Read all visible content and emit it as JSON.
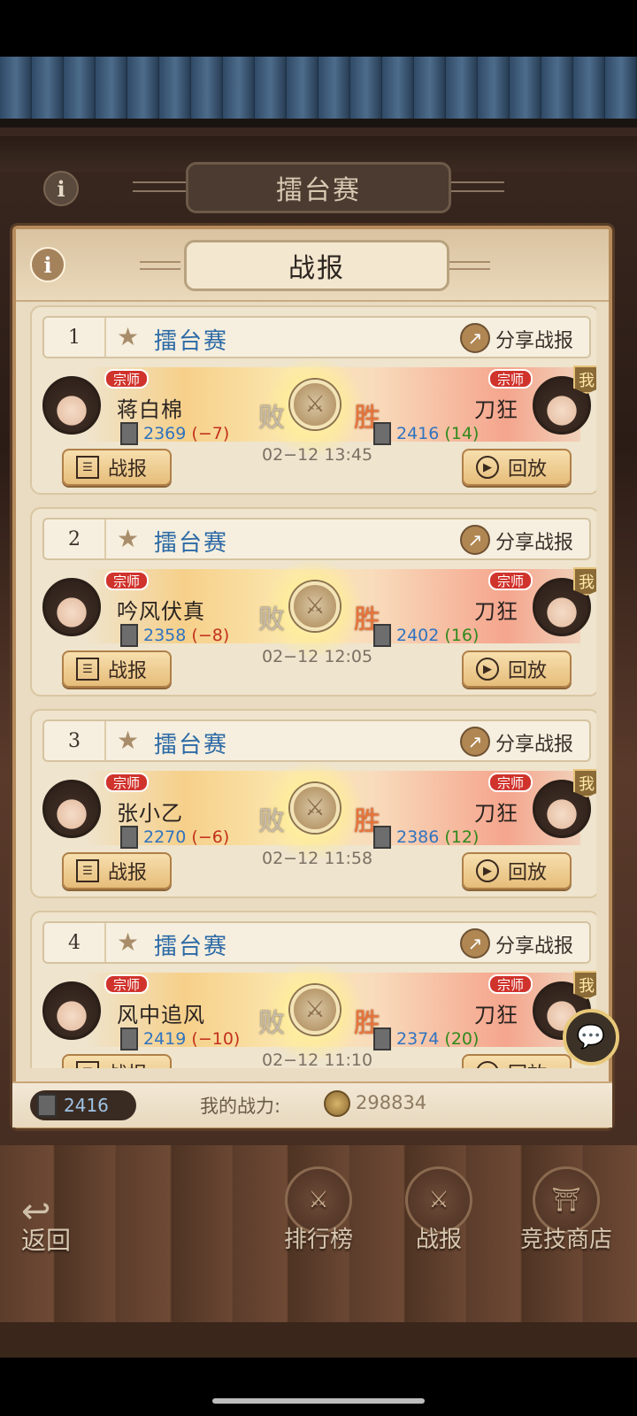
{
  "page": {
    "title": "擂台赛"
  },
  "panel": {
    "title": "战报"
  },
  "reports": [
    {
      "rank": "1",
      "mode": "擂台赛",
      "share_label": "分享战报",
      "left": {
        "tag": "宗师",
        "name": "蒋白棉",
        "rating": "2369",
        "delta": "(−7)"
      },
      "right": {
        "tag": "宗师",
        "name": "刀狂",
        "rating": "2416",
        "delta": "(14)",
        "badge": "我"
      },
      "left_result": "败",
      "right_result": "胜",
      "time": "02−12 13:45",
      "report_label": "战报",
      "replay_label": "回放"
    },
    {
      "rank": "2",
      "mode": "擂台赛",
      "share_label": "分享战报",
      "left": {
        "tag": "宗师",
        "name": "吟风伏真",
        "rating": "2358",
        "delta": "(−8)"
      },
      "right": {
        "tag": "宗师",
        "name": "刀狂",
        "rating": "2402",
        "delta": "(16)",
        "badge": "我"
      },
      "left_result": "败",
      "right_result": "胜",
      "time": "02−12 12:05",
      "report_label": "战报",
      "replay_label": "回放"
    },
    {
      "rank": "3",
      "mode": "擂台赛",
      "share_label": "分享战报",
      "left": {
        "tag": "宗师",
        "name": "张小乙",
        "rating": "2270",
        "delta": "(−6)"
      },
      "right": {
        "tag": "宗师",
        "name": "刀狂",
        "rating": "2386",
        "delta": "(12)",
        "badge": "我"
      },
      "left_result": "败",
      "right_result": "胜",
      "time": "02−12 11:58",
      "report_label": "战报",
      "replay_label": "回放"
    },
    {
      "rank": "4",
      "mode": "擂台赛",
      "share_label": "分享战报",
      "left": {
        "tag": "宗师",
        "name": "风中追风",
        "rating": "2419",
        "delta": "(−10)"
      },
      "right": {
        "tag": "宗师",
        "name": "刀狂",
        "rating": "2374",
        "delta": "(20)",
        "badge": "我"
      },
      "left_result": "败",
      "right_result": "胜",
      "time": "02−12 11:10",
      "report_label": "战报",
      "replay_label": "回放"
    }
  ],
  "footer": {
    "my_rating": "2416",
    "power_label": "我的战力:",
    "power_value": "298834"
  },
  "nav": {
    "back": "返回",
    "leaderboard": "排行榜",
    "reports": "战报",
    "shop": "竞技商店"
  },
  "icons": {
    "info": "info-icon",
    "star": "star-icon",
    "share": "share-icon",
    "report": "list-icon",
    "replay": "play-icon",
    "chat": "chat-icon",
    "back": "back-arrow-icon"
  },
  "colors": {
    "mode_text": "#2d6aa6",
    "rating_text": "#2f73c0",
    "delta_negative": "#c2311e",
    "delta_positive": "#2f8a1c",
    "title_tag": "#d0332c",
    "win": "#e8743a"
  }
}
